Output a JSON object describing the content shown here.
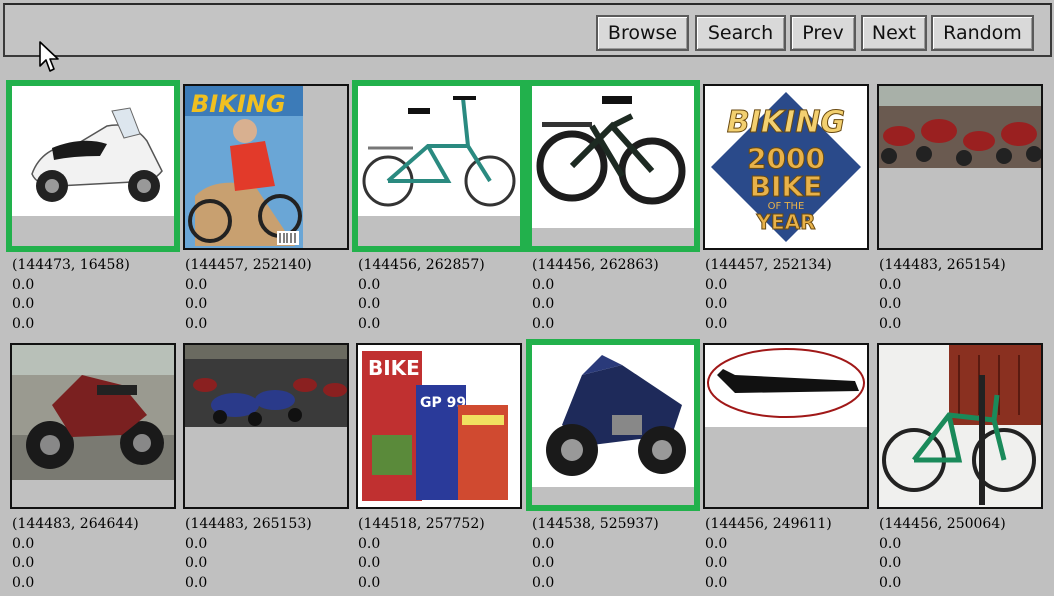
{
  "toolbar": {
    "browse": "Browse",
    "search": "Search",
    "prev": "Prev",
    "next": "Next",
    "random": "Random"
  },
  "items": [
    {
      "image": "white-scooter",
      "id": "(144473, 16458)",
      "v1": "0.0",
      "v2": "0.0",
      "v3": "0.0",
      "selected": true
    },
    {
      "image": "biking-magazine-cover",
      "id": "(144457, 252140)",
      "v1": "0.0",
      "v2": "0.0",
      "v3": "0.0",
      "selected": false
    },
    {
      "image": "folding-bike-white",
      "id": "(144456, 262857)",
      "v1": "0.0",
      "v2": "0.0",
      "v3": "0.0",
      "selected": true
    },
    {
      "image": "folding-bike-black",
      "id": "(144456, 262863)",
      "v1": "0.0",
      "v2": "0.0",
      "v3": "0.0",
      "selected": true
    },
    {
      "image": "bike-of-the-year-logo",
      "id": "(144457, 252134)",
      "v1": "0.0",
      "v2": "0.0",
      "v3": "0.0",
      "selected": false
    },
    {
      "image": "motorcycle-parking",
      "id": "(144483, 265154)",
      "v1": "0.0",
      "v2": "0.0",
      "v3": "0.0",
      "selected": false
    },
    {
      "image": "red-motorcycle",
      "id": "(144483, 264644)",
      "v1": "0.0",
      "v2": "0.0",
      "v3": "0.0",
      "selected": false
    },
    {
      "image": "motorcycle-rows",
      "id": "(144483, 265153)",
      "v1": "0.0",
      "v2": "0.0",
      "v3": "0.0",
      "selected": false
    },
    {
      "image": "bike-gp-magazines",
      "id": "(144518, 257752)",
      "v1": "0.0",
      "v2": "0.0",
      "v3": "0.0",
      "selected": false
    },
    {
      "image": "blue-touring-motorcycle",
      "id": "(144538, 525937)",
      "v1": "0.0",
      "v2": "0.0",
      "v3": "0.0",
      "selected": true
    },
    {
      "image": "bike-saddle-tool",
      "id": "(144456, 249611)",
      "v1": "0.0",
      "v2": "0.0",
      "v3": "0.0",
      "selected": false
    },
    {
      "image": "green-bike-rack",
      "id": "(144456, 250064)",
      "v1": "0.0",
      "v2": "0.0",
      "v3": "0.0",
      "selected": false
    }
  ],
  "thumb_text": {
    "magazine_title": "BIKING",
    "logo_line1": "BIKING",
    "logo_line2": "2000",
    "logo_line3": "BIKE",
    "logo_line4": "OF THE",
    "logo_line5": "YEAR",
    "gp_title": "BIKE",
    "gp_sub": "GP 99"
  },
  "colors": {
    "background": "#c0c0c0",
    "selection": "#22b14c",
    "button": "#d9d9d9"
  }
}
